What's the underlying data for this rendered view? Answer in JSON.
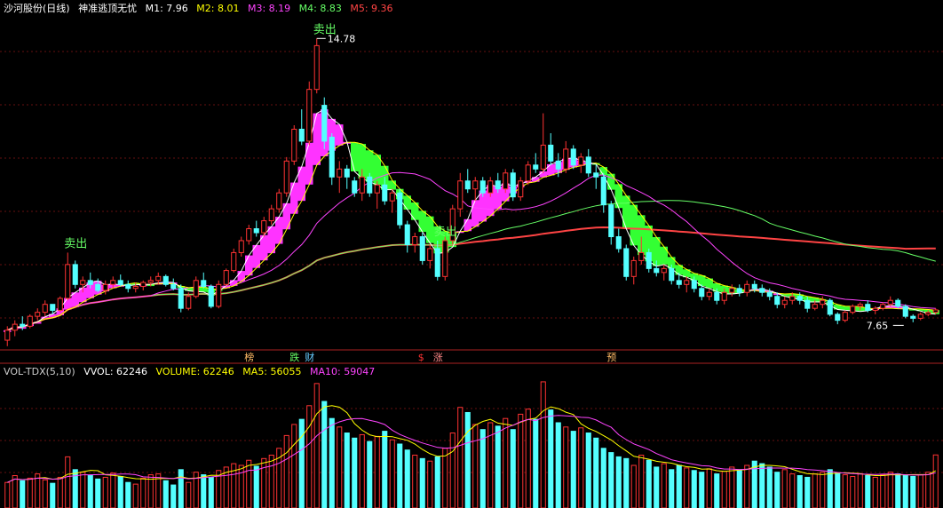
{
  "main_header": {
    "stock_name": "沙河股份(日线)",
    "indicator_name": "神准逃顶无忧",
    "ma": [
      {
        "label": "M1: 7.96",
        "color": "#ffffff"
      },
      {
        "label": "M2: 8.01",
        "color": "#ffff00"
      },
      {
        "label": "M3: 8.19",
        "color": "#ff44ff"
      },
      {
        "label": "M4: 8.83",
        "color": "#66ff66"
      },
      {
        "label": "M5: 9.36",
        "color": "#ff4444"
      }
    ]
  },
  "vol_header": {
    "indicator": "VOL-TDX(5,10)",
    "vvol": "VVOL: 62246",
    "volume": "VOLUME: 62246",
    "ma5": "MA5: 56055",
    "ma10": "MA10: 59047"
  },
  "annotations": {
    "sell_signal": "卖出",
    "high_label": "14.78",
    "low_label": "7.65"
  },
  "event_markers": [
    {
      "text": "榜",
      "color": "#ffbb66"
    },
    {
      "text": "跌",
      "color": "#66ff66"
    },
    {
      "text": "财",
      "color": "#66ccff"
    },
    {
      "text": "$",
      "color": "#ff3333"
    },
    {
      "text": "涨",
      "color": "#ff8888"
    },
    {
      "text": "预",
      "color": "#ffbb66"
    }
  ],
  "colors": {
    "up": "#ff3333",
    "down": "#54ffff",
    "buy_zone": "#ff33ff",
    "sell_zone": "#33ff33",
    "grid": "#661111"
  },
  "chart_data": {
    "type": "candlestick",
    "price_range": [
      7.0,
      15.3
    ],
    "candles": [
      [
        7.2,
        7.55,
        7.05,
        7.45
      ],
      [
        7.45,
        7.7,
        7.3,
        7.6
      ],
      [
        7.6,
        7.8,
        7.45,
        7.55
      ],
      [
        7.55,
        7.85,
        7.5,
        7.8
      ],
      [
        7.8,
        8.0,
        7.7,
        7.9
      ],
      [
        7.9,
        8.2,
        7.8,
        8.1
      ],
      [
        8.1,
        8.1,
        7.85,
        7.95
      ],
      [
        7.95,
        8.3,
        7.9,
        8.25
      ],
      [
        8.25,
        9.4,
        8.2,
        9.1
      ],
      [
        9.1,
        9.2,
        8.5,
        8.6
      ],
      [
        8.6,
        8.8,
        8.4,
        8.7
      ],
      [
        8.7,
        8.9,
        8.5,
        8.6
      ],
      [
        8.6,
        8.75,
        8.4,
        8.45
      ],
      [
        8.45,
        8.7,
        8.35,
        8.6
      ],
      [
        8.6,
        8.8,
        8.5,
        8.7
      ],
      [
        8.7,
        8.85,
        8.55,
        8.6
      ],
      [
        8.6,
        8.7,
        8.4,
        8.5
      ],
      [
        8.5,
        8.65,
        8.4,
        8.55
      ],
      [
        8.55,
        8.7,
        8.45,
        8.65
      ],
      [
        8.65,
        8.8,
        8.55,
        8.7
      ],
      [
        8.7,
        8.9,
        8.6,
        8.8
      ],
      [
        8.8,
        8.85,
        8.55,
        8.6
      ],
      [
        8.6,
        8.75,
        8.45,
        8.5
      ],
      [
        8.5,
        8.6,
        7.9,
        8.0
      ],
      [
        8.0,
        8.4,
        7.95,
        8.3
      ],
      [
        8.3,
        8.8,
        8.25,
        8.7
      ],
      [
        8.7,
        8.9,
        8.5,
        8.55
      ],
      [
        8.55,
        8.6,
        8.0,
        8.05
      ],
      [
        8.05,
        8.7,
        8.0,
        8.6
      ],
      [
        8.6,
        9.0,
        8.55,
        8.95
      ],
      [
        8.95,
        9.5,
        8.9,
        9.4
      ],
      [
        9.4,
        9.8,
        9.3,
        9.7
      ],
      [
        9.7,
        10.1,
        9.6,
        10.0
      ],
      [
        10.0,
        10.2,
        9.8,
        9.9
      ],
      [
        9.9,
        10.3,
        9.8,
        10.2
      ],
      [
        10.2,
        10.6,
        10.1,
        10.5
      ],
      [
        10.5,
        11.0,
        10.4,
        10.9
      ],
      [
        10.9,
        11.8,
        10.8,
        11.7
      ],
      [
        11.7,
        12.6,
        11.6,
        12.5
      ],
      [
        12.5,
        13.0,
        12.1,
        12.2
      ],
      [
        12.2,
        13.7,
        12.1,
        13.5
      ],
      [
        13.5,
        14.78,
        13.4,
        14.6
      ],
      [
        13.1,
        13.3,
        12.0,
        12.2
      ],
      [
        12.3,
        12.4,
        11.1,
        11.3
      ],
      [
        11.3,
        11.7,
        10.9,
        11.5
      ],
      [
        11.5,
        11.6,
        11.0,
        11.3
      ],
      [
        11.2,
        11.3,
        10.8,
        10.9
      ],
      [
        10.9,
        11.5,
        10.7,
        11.3
      ],
      [
        11.3,
        11.4,
        10.8,
        10.9
      ],
      [
        10.9,
        11.2,
        10.5,
        11.1
      ],
      [
        11.1,
        11.3,
        10.6,
        10.7
      ],
      [
        10.7,
        11.0,
        10.4,
        10.9
      ],
      [
        10.9,
        11.0,
        10.0,
        10.1
      ],
      [
        10.1,
        10.2,
        9.4,
        9.6
      ],
      [
        9.6,
        9.9,
        9.4,
        9.8
      ],
      [
        9.8,
        9.9,
        9.1,
        9.2
      ],
      [
        9.2,
        9.6,
        9.0,
        9.5
      ],
      [
        9.5,
        9.7,
        8.7,
        8.8
      ],
      [
        8.8,
        9.8,
        8.7,
        9.7
      ],
      [
        9.7,
        10.6,
        9.6,
        10.5
      ],
      [
        10.5,
        11.4,
        10.3,
        11.2
      ],
      [
        11.2,
        11.5,
        10.9,
        11.0
      ],
      [
        11.0,
        11.3,
        10.7,
        11.2
      ],
      [
        11.2,
        11.3,
        10.8,
        10.9
      ],
      [
        10.9,
        11.3,
        10.8,
        11.2
      ],
      [
        11.2,
        11.4,
        10.9,
        11.0
      ],
      [
        11.0,
        11.5,
        10.9,
        11.4
      ],
      [
        11.4,
        11.5,
        10.7,
        10.8
      ],
      [
        10.8,
        11.3,
        10.7,
        11.2
      ],
      [
        11.2,
        11.7,
        11.1,
        11.6
      ],
      [
        11.6,
        11.9,
        11.4,
        11.5
      ],
      [
        11.5,
        12.9,
        11.4,
        12.1
      ],
      [
        12.1,
        12.4,
        11.6,
        11.7
      ],
      [
        11.7,
        11.9,
        11.3,
        11.5
      ],
      [
        11.5,
        12.2,
        11.4,
        12.0
      ],
      [
        12.0,
        12.1,
        11.5,
        11.6
      ],
      [
        11.6,
        11.9,
        11.4,
        11.8
      ],
      [
        11.8,
        12.0,
        11.3,
        11.4
      ],
      [
        11.4,
        11.6,
        11.0,
        11.3
      ],
      [
        11.3,
        11.4,
        10.4,
        10.6
      ],
      [
        10.6,
        10.7,
        9.6,
        9.8
      ],
      [
        9.8,
        10.0,
        9.4,
        9.5
      ],
      [
        9.5,
        9.6,
        8.7,
        8.8
      ],
      [
        8.8,
        9.3,
        8.6,
        9.2
      ],
      [
        9.2,
        9.8,
        9.1,
        9.4
      ],
      [
        9.4,
        9.5,
        8.9,
        9.0
      ],
      [
        9.0,
        9.2,
        8.8,
        8.9
      ],
      [
        8.9,
        9.1,
        8.7,
        9.0
      ],
      [
        9.0,
        9.1,
        8.6,
        8.7
      ],
      [
        8.7,
        8.9,
        8.5,
        8.6
      ],
      [
        8.6,
        8.8,
        8.4,
        8.7
      ],
      [
        8.7,
        8.8,
        8.4,
        8.5
      ],
      [
        8.5,
        8.6,
        8.2,
        8.3
      ],
      [
        8.3,
        8.5,
        8.2,
        8.4
      ],
      [
        8.4,
        8.5,
        8.1,
        8.2
      ],
      [
        8.2,
        8.5,
        8.1,
        8.4
      ],
      [
        8.4,
        8.6,
        8.3,
        8.5
      ],
      [
        8.5,
        8.6,
        8.3,
        8.4
      ],
      [
        8.4,
        8.7,
        8.3,
        8.6
      ],
      [
        8.6,
        8.7,
        8.4,
        8.5
      ],
      [
        8.5,
        8.6,
        8.3,
        8.4
      ],
      [
        8.4,
        8.5,
        8.2,
        8.3
      ],
      [
        8.3,
        8.4,
        8.0,
        8.1
      ],
      [
        8.1,
        8.3,
        8.0,
        8.2
      ],
      [
        8.2,
        8.4,
        8.1,
        8.3
      ],
      [
        8.3,
        8.4,
        8.1,
        8.2
      ],
      [
        8.2,
        8.3,
        7.9,
        8.0
      ],
      [
        8.0,
        8.2,
        7.95,
        8.1
      ],
      [
        8.1,
        8.3,
        8.0,
        8.2
      ],
      [
        8.2,
        8.25,
        7.8,
        7.85
      ],
      [
        7.85,
        7.9,
        7.6,
        7.7
      ],
      [
        7.7,
        7.95,
        7.65,
        7.9
      ],
      [
        7.9,
        8.1,
        7.85,
        8.05
      ],
      [
        8.05,
        8.15,
        7.95,
        8.1
      ],
      [
        8.1,
        8.2,
        7.9,
        7.95
      ],
      [
        7.95,
        8.05,
        7.85,
        8.0
      ],
      [
        8.0,
        8.15,
        7.95,
        8.1
      ],
      [
        8.1,
        8.3,
        8.05,
        8.2
      ],
      [
        8.2,
        8.25,
        8.0,
        8.05
      ],
      [
        8.05,
        8.1,
        7.75,
        7.8
      ],
      [
        7.8,
        7.85,
        7.65,
        7.75
      ],
      [
        7.75,
        7.9,
        7.7,
        7.85
      ],
      [
        7.85,
        7.95,
        7.8,
        7.9
      ],
      [
        7.9,
        8.0,
        7.85,
        7.96
      ]
    ],
    "volume_range": [
      0,
      150000
    ],
    "volumes": [
      30000,
      38000,
      32000,
      35000,
      40000,
      33000,
      29000,
      36000,
      60000,
      45000,
      42000,
      38000,
      34000,
      36000,
      41000,
      37000,
      30000,
      28000,
      35000,
      39000,
      40000,
      32000,
      27000,
      45000,
      30000,
      42000,
      39000,
      36000,
      44000,
      48000,
      52000,
      50000,
      56000,
      49000,
      58000,
      62000,
      70000,
      85000,
      98000,
      104000,
      120000,
      146000,
      125000,
      105000,
      95000,
      88000,
      82000,
      86000,
      78000,
      84000,
      90000,
      80000,
      75000,
      68000,
      62000,
      58000,
      55000,
      60000,
      70000,
      88000,
      118000,
      112000,
      98000,
      92000,
      100000,
      96000,
      105000,
      92000,
      110000,
      116000,
      104000,
      148000,
      115000,
      100000,
      95000,
      90000,
      94000,
      88000,
      82000,
      70000,
      65000,
      60000,
      58000,
      50000,
      62000,
      56000,
      48000,
      52000,
      45000,
      50000,
      47000,
      44000,
      42000,
      46000,
      40000,
      43000,
      48000,
      45000,
      50000,
      55000,
      52000,
      48000,
      42000,
      45000,
      40000,
      38000,
      36000,
      40000,
      42000,
      45000,
      41000,
      39000,
      37000,
      40000,
      38000,
      36000,
      39000,
      42000,
      40000,
      38000,
      37000,
      39000,
      42000,
      62246
    ],
    "ma_windows": {
      "M1": 5,
      "M2": 10,
      "M3": 20,
      "M4": 60,
      "M5": 120
    },
    "sell_signal_indices": [
      8,
      41,
      57
    ],
    "high_index": 41,
    "low_index": 119,
    "event_marker_indices": [
      32,
      38,
      40,
      55,
      57,
      80
    ]
  }
}
